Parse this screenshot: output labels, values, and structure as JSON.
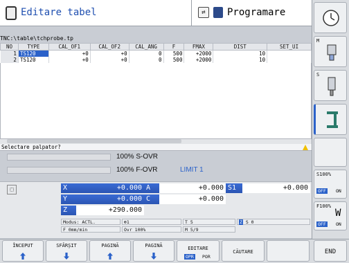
{
  "header": {
    "left_title": "Editare tabel",
    "right_title": "Programare",
    "mode_icon": "switch-icon"
  },
  "table": {
    "path": "TNC:\\table\\tchprobe.tp",
    "columns": [
      "NO",
      "TYPE",
      "CAL_OF1",
      "CAL_OF2",
      "CAL_ANG",
      "F",
      "FMAX",
      "DIST",
      "SET_UI"
    ],
    "rows": [
      [
        "1",
        "TS120",
        "+0",
        "+0",
        "0",
        "500",
        "+2000",
        "10",
        ""
      ],
      [
        "2",
        "TS120",
        "+0",
        "+0",
        "0",
        "500",
        "+2000",
        "10",
        ""
      ]
    ]
  },
  "status": {
    "prompt": "Selectare palpator?"
  },
  "override": {
    "s_ovr": "100% S-OVR",
    "f_ovr": "100% F-OVR",
    "limit": "LIMIT 1"
  },
  "axes": {
    "x_label": "X",
    "x_value": "+0.000",
    "a_label": "A",
    "a_value": "+0.000",
    "s1_label": "S1",
    "s1_value": "+0.000",
    "y_label": "Y",
    "y_value": "+0.000",
    "c_label": "C",
    "c_value": "+0.000",
    "z_label": "Z",
    "z_value": "+290.000"
  },
  "info": {
    "modus": "Modus: ACTL.",
    "tool_num": "1",
    "t_value": "T 5",
    "spindle": "S 0",
    "feed": "F 0mm/min",
    "ovr": "Ovr 100%",
    "m_value": "M 5/9",
    "z_badge": "Z"
  },
  "right_softkeys": {
    "m_label": "M",
    "s_label": "S",
    "s100_label": "S100%",
    "f100_label": "F100%",
    "off": "OFF",
    "on": "ON"
  },
  "softkeys": {
    "inceput": "ÎNCEPUT",
    "sfarsit": "SFÂRȘIT",
    "pagina_up": "PAGINĂ",
    "pagina_down": "PAGINĂ",
    "editare": "EDITARE",
    "opr": "OPR",
    "por": "POR",
    "cautare": "CĂUTARE",
    "end": "END"
  },
  "colors": {
    "accent": "#2a61c9",
    "header_title": "#1f4fb0"
  }
}
